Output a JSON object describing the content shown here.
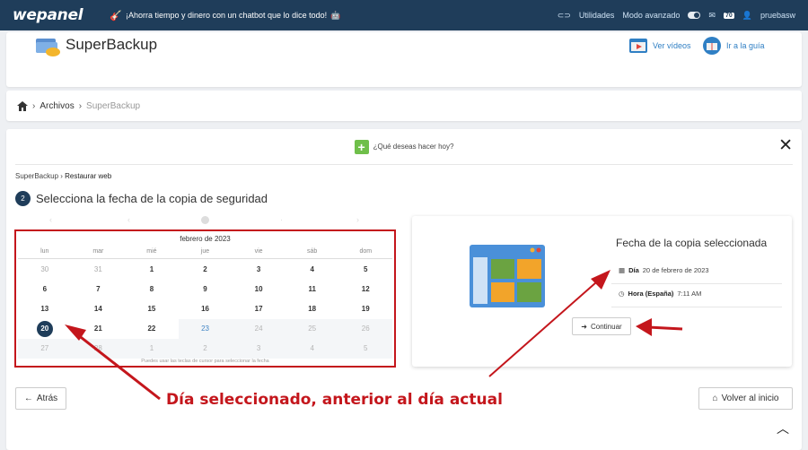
{
  "topbar": {
    "logo": "wepanel",
    "promo": "¡Ahorra tiempo y dinero con un chatbot que lo dice todo!",
    "utilities_label": "Utilidades",
    "advanced_mode_label": "Modo avanzado",
    "messages_count": "70",
    "username": "pruebasw",
    "colors": {
      "bar": "#1f3d5a"
    }
  },
  "header": {
    "title": "SuperBackup",
    "videos_label": "Ver vídeos",
    "guide_label": "Ir a la guía"
  },
  "breadcrumb": {
    "items": [
      "Archivos",
      "SuperBackup"
    ]
  },
  "main": {
    "question": "¿Qué deseas hacer hoy?",
    "sub_breadcrumb_root": "SuperBackup",
    "sub_breadcrumb_current": "Restaurar web",
    "step_number": "2",
    "step_title": "Selecciona la fecha de la copia de seguridad"
  },
  "calendar": {
    "month_label": "febrero de 2023",
    "weekdays": [
      "lun",
      "mar",
      "mié",
      "jue",
      "vie",
      "sáb",
      "dom"
    ],
    "rows": [
      [
        "30",
        "31",
        "1",
        "2",
        "3",
        "4",
        "5"
      ],
      [
        "6",
        "7",
        "8",
        "9",
        "10",
        "11",
        "12"
      ],
      [
        "13",
        "14",
        "15",
        "16",
        "17",
        "18",
        "19"
      ],
      [
        "20",
        "21",
        "22",
        "23",
        "24",
        "25",
        "26"
      ],
      [
        "27",
        "28",
        "1",
        "2",
        "3",
        "4",
        "5"
      ]
    ],
    "selected_day": "20",
    "today_day": "23",
    "hint": "Puedes usar las teclas de cursor para seleccionar la fecha"
  },
  "selection": {
    "title": "Fecha de la copia seleccionada",
    "day_label": "Día",
    "day_value": "20 de febrero de 2023",
    "time_label": "Hora (España)",
    "time_value": "7:11 AM",
    "continue_label": "Continuar"
  },
  "footer": {
    "back_label": "Atrás",
    "home_label": "Volver al inicio"
  },
  "annotation": {
    "text": "Día seleccionado, anterior al día actual",
    "color": "#c4161c"
  }
}
